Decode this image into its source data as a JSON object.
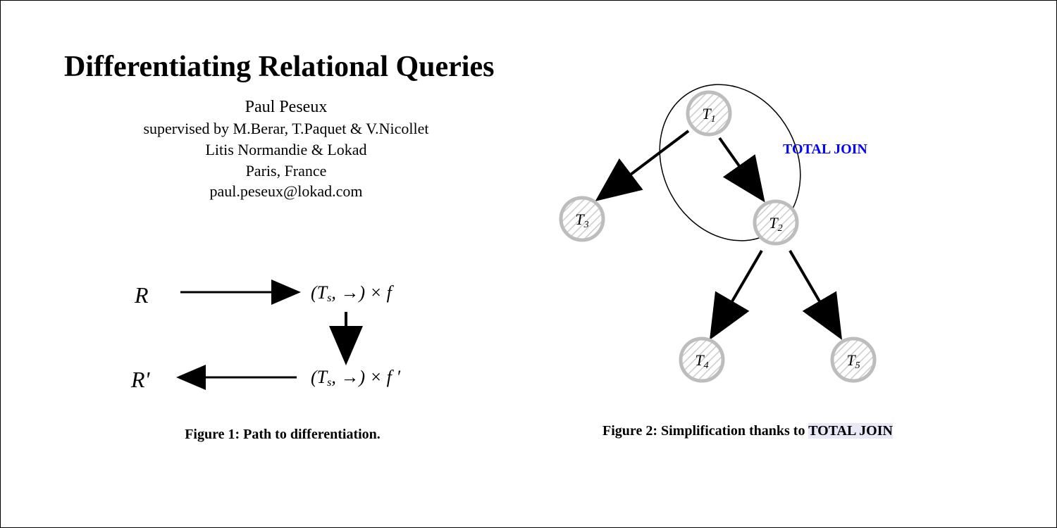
{
  "title": "Differentiating Relational Queries",
  "authors": {
    "name": "Paul Peseux",
    "supervised": "supervised by M.Berar, T.Paquet & V.Nicollet",
    "affiliation1": "Litis Normandie & Lokad",
    "affiliation2": "Paris, France",
    "email": "paul.peseux@lokad.com"
  },
  "fig1": {
    "caption": "Figure 1: Path to differentiation.",
    "left_top": "R",
    "left_bottom": "R'",
    "right_top_pre": "(T",
    "right_top_sub": "s",
    "right_top_post": ", →) × f",
    "right_bottom_pre": "(T",
    "right_bottom_sub": "s",
    "right_bottom_post": ", →) × f ′"
  },
  "fig2": {
    "caption_prefix": "Figure 2: Simplification thanks to ",
    "caption_tj": "TOTAL JOIN",
    "total_join_label": "TOTAL JOIN",
    "nodes": {
      "T1": "T",
      "T1s": "1",
      "T2": "T",
      "T2s": "2",
      "T3": "T",
      "T3s": "3",
      "T4": "T",
      "T4s": "4",
      "T5": "T",
      "T5s": "5"
    }
  }
}
